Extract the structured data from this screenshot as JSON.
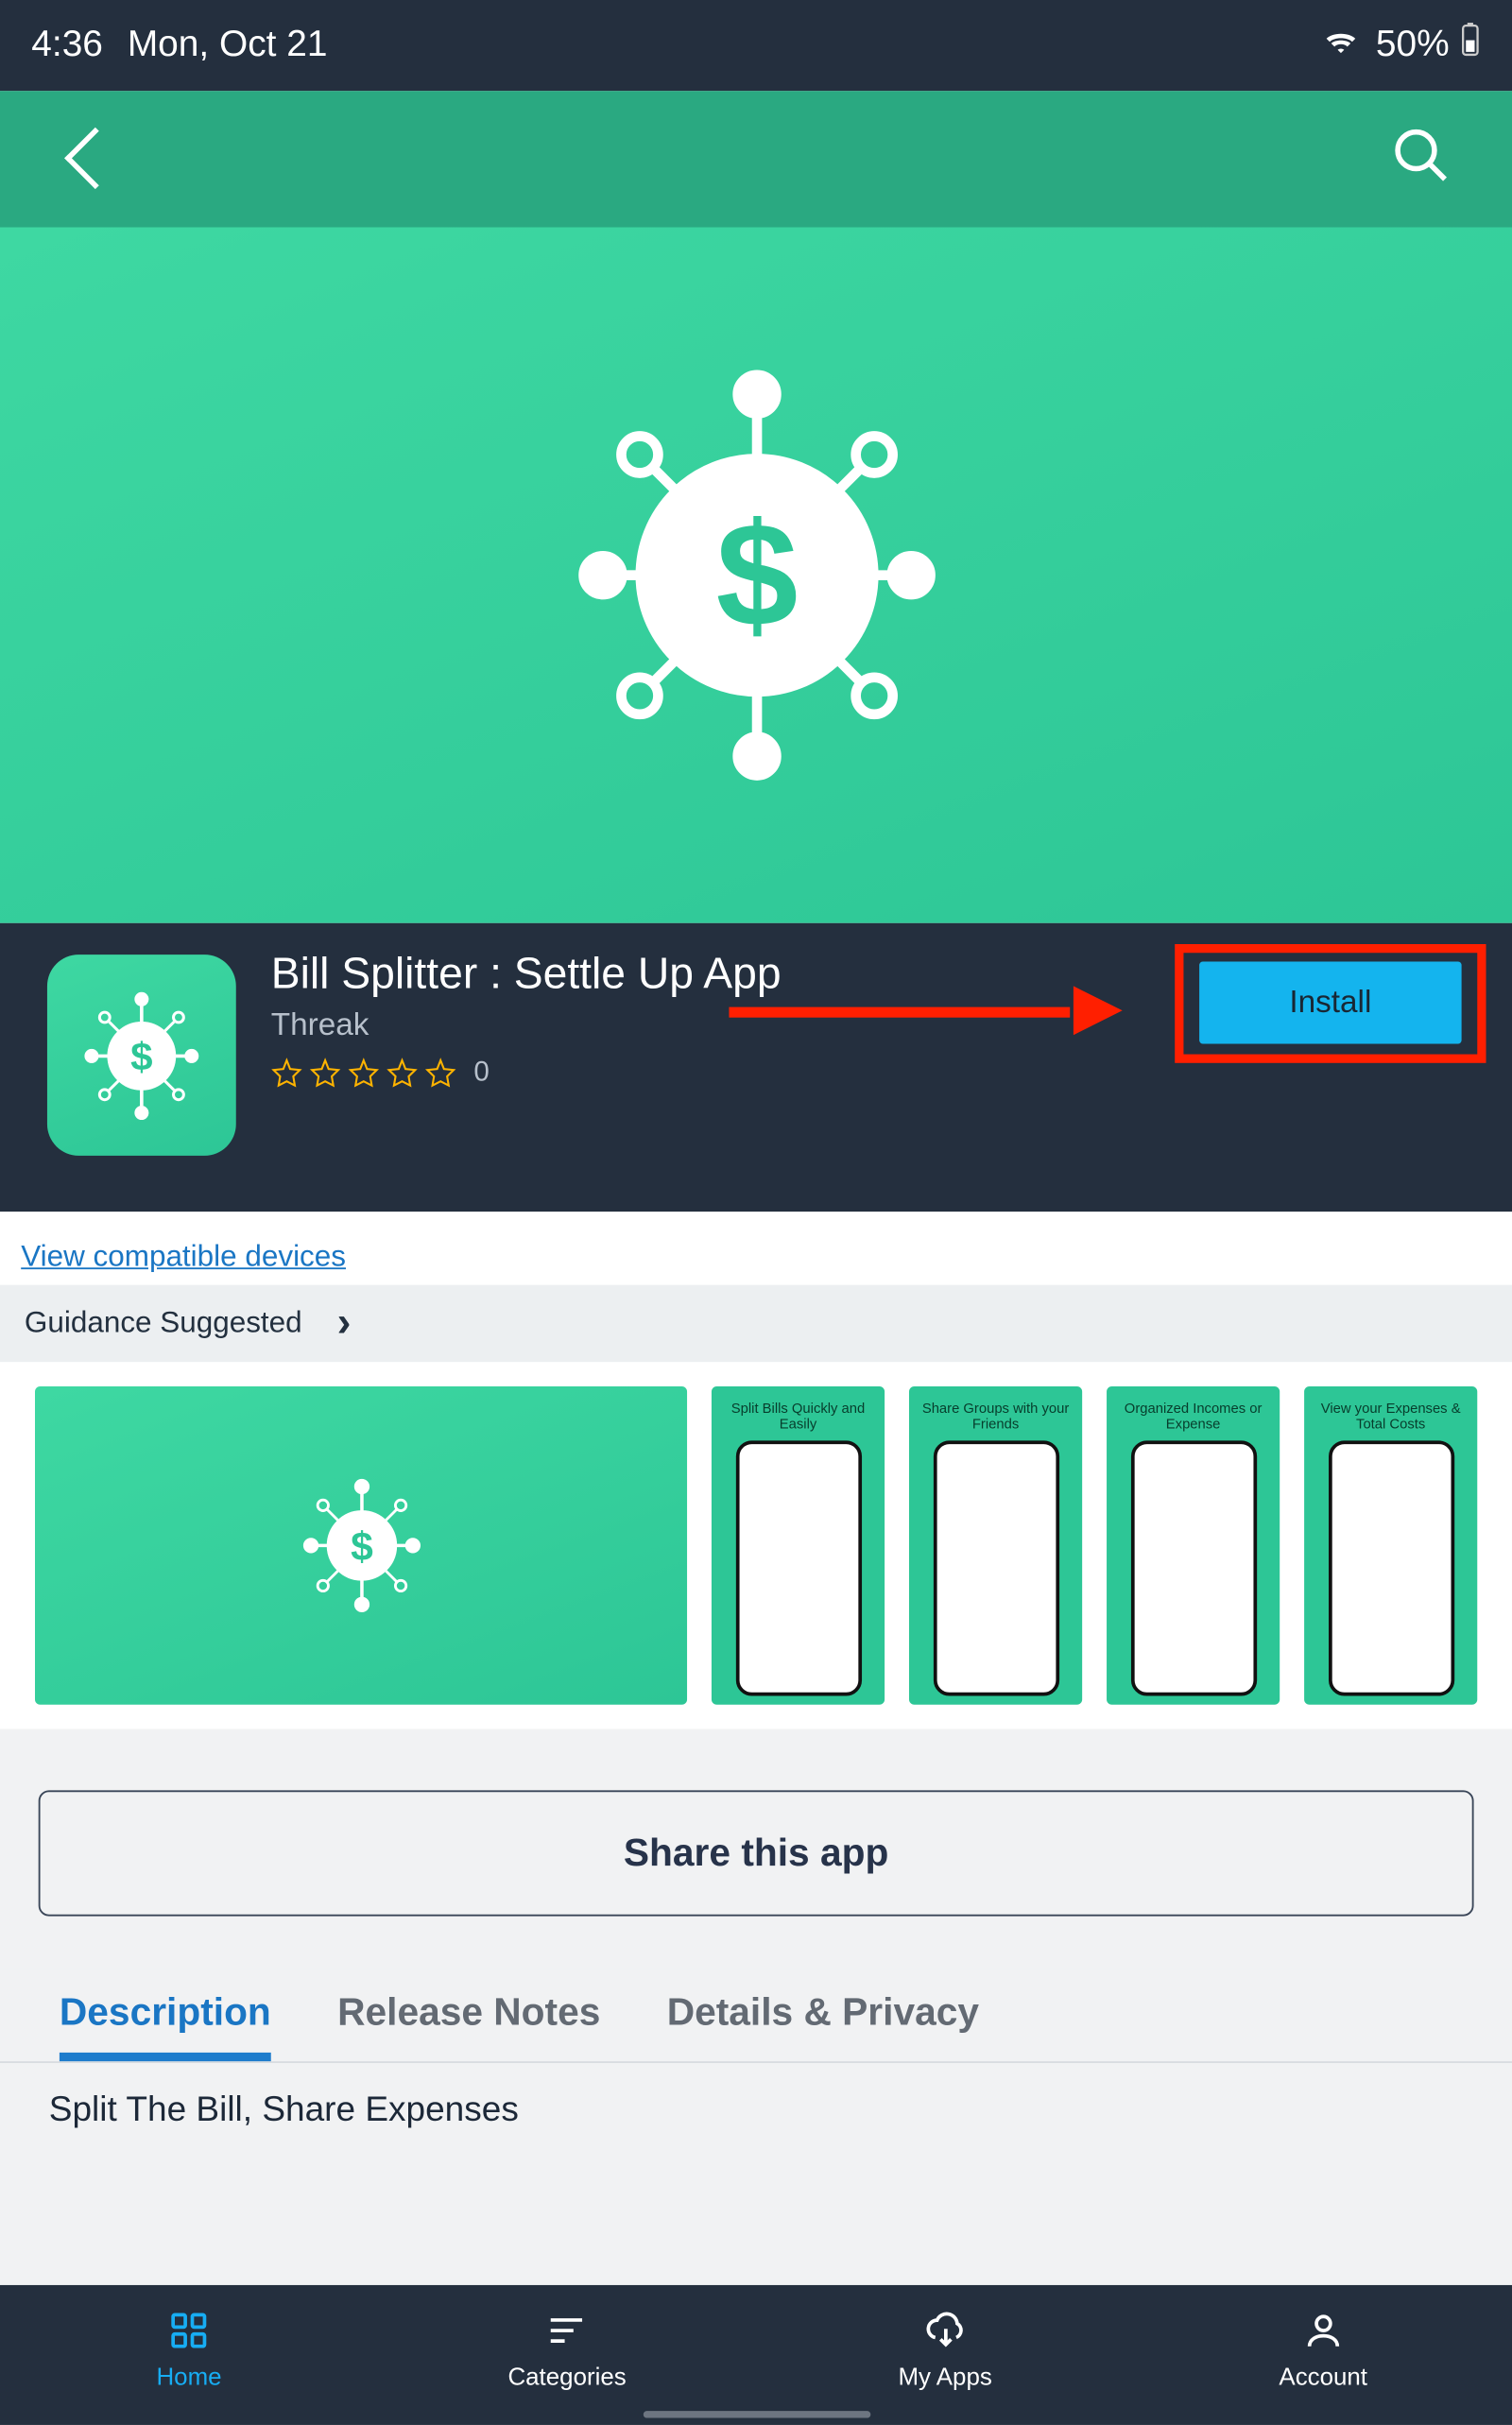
{
  "statusbar": {
    "time": "4:36",
    "date": "Mon, Oct 21",
    "battery": "50%"
  },
  "app": {
    "title": "Bill Splitter : Settle Up App",
    "developer": "Threak",
    "rating_count": "0"
  },
  "actions": {
    "install": "Install",
    "compat_link": "View compatible devices",
    "guidance": "Guidance Suggested",
    "share": "Share this app"
  },
  "shots": {
    "s1": "Split Bills Quickly and Easily",
    "s2": "Share Groups with your Friends",
    "s3": "Organized Incomes or Expense",
    "s4": "View your Expenses & Total Costs"
  },
  "tabs": {
    "t1": "Description",
    "t2": "Release Notes",
    "t3": "Details & Privacy"
  },
  "description_line": "Split The Bill, Share Expenses",
  "bottom": {
    "home": "Home",
    "categories": "Categories",
    "myapps": "My Apps",
    "account": "Account"
  }
}
